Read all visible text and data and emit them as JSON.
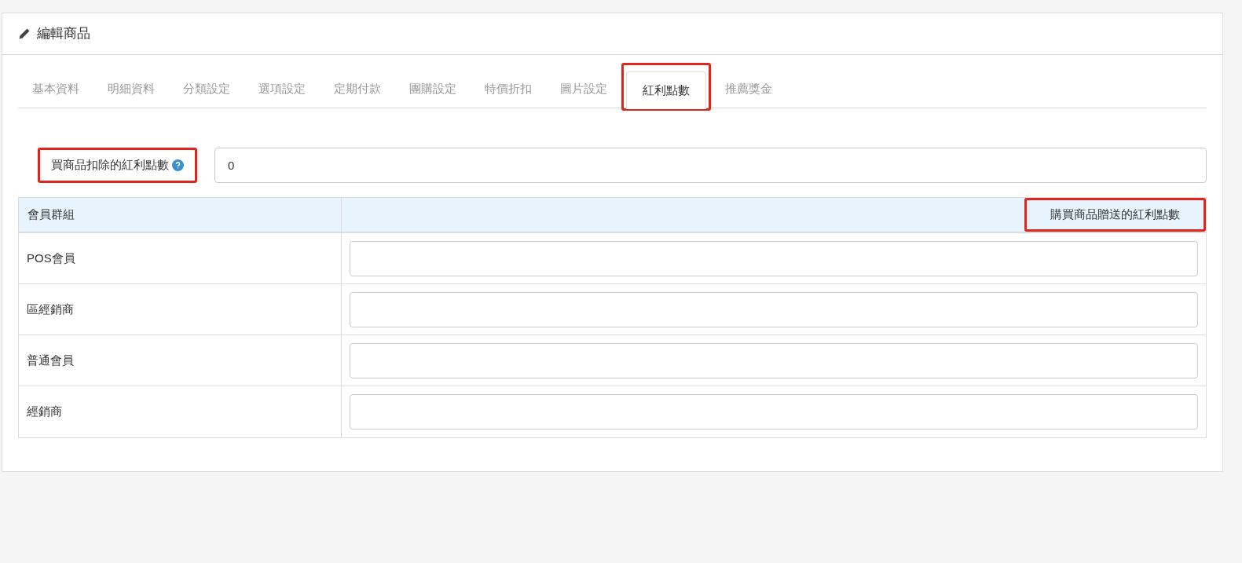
{
  "panel": {
    "title": "編輯商品"
  },
  "tabs": [
    {
      "label": "基本資料",
      "selected": false,
      "highlighted": false
    },
    {
      "label": "明細資料",
      "selected": false,
      "highlighted": false
    },
    {
      "label": "分類設定",
      "selected": false,
      "highlighted": false
    },
    {
      "label": "選項設定",
      "selected": false,
      "highlighted": false
    },
    {
      "label": "定期付款",
      "selected": false,
      "highlighted": false
    },
    {
      "label": "團購設定",
      "selected": false,
      "highlighted": false
    },
    {
      "label": "特價折扣",
      "selected": false,
      "highlighted": false
    },
    {
      "label": "圖片設定",
      "selected": false,
      "highlighted": false
    },
    {
      "label": "紅利點數",
      "selected": true,
      "highlighted": true
    },
    {
      "label": "推薦獎金",
      "selected": false,
      "highlighted": false
    }
  ],
  "deduct_field": {
    "label": "買商品扣除的紅利點數",
    "value": "0",
    "highlighted": true
  },
  "table": {
    "columns": [
      {
        "label": "會員群組",
        "highlighted": false
      },
      {
        "label": "購買商品贈送的紅利點數",
        "highlighted": true
      }
    ],
    "rows": [
      {
        "group": "POS會員"
      },
      {
        "group": "區經銷商"
      },
      {
        "group": "普通會員"
      },
      {
        "group": "經銷商"
      }
    ]
  }
}
